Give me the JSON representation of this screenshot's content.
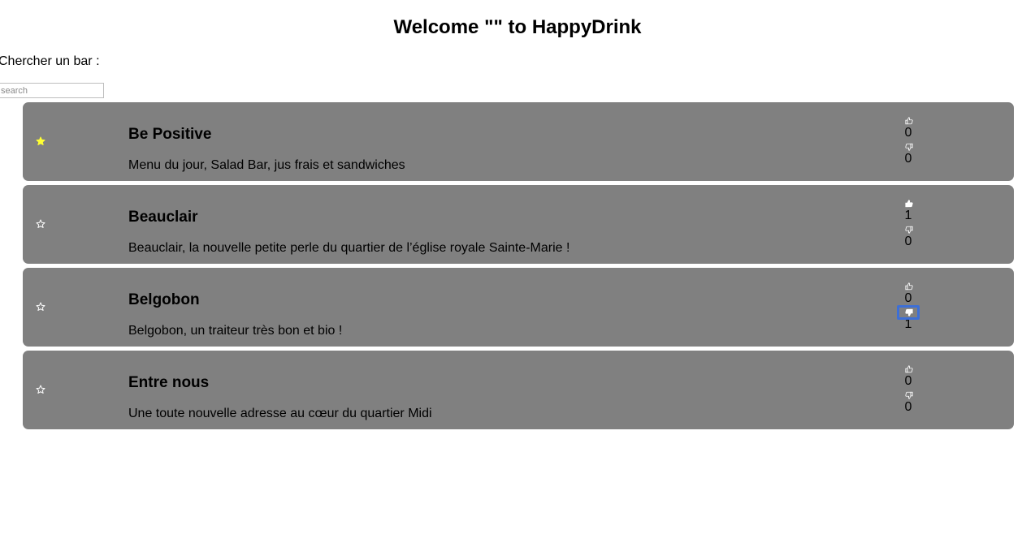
{
  "header": {
    "title": "Welcome \"\" to HappyDrink"
  },
  "search": {
    "label": "Chercher un bar :",
    "placeholder": "search",
    "value": ""
  },
  "colors": {
    "card_bg": "#808080",
    "favorite_star": "#ffff33",
    "focus_ring": "#3d6fd6"
  },
  "bars": [
    {
      "name": "Be Positive",
      "description": "Menu du jour, Salad Bar, jus frais et sandwiches",
      "favorite": true,
      "likes": "0",
      "dislikes": "0",
      "liked": false,
      "disliked": false,
      "focused": ""
    },
    {
      "name": "Beauclair",
      "description": "Beauclair, la nouvelle petite perle du quartier de l’église royale Sainte-Marie !",
      "favorite": false,
      "likes": "1",
      "dislikes": "0",
      "liked": true,
      "disliked": false,
      "focused": ""
    },
    {
      "name": "Belgobon",
      "description": "Belgobon, un traiteur très bon et bio !",
      "favorite": false,
      "likes": "0",
      "dislikes": "1",
      "liked": false,
      "disliked": true,
      "focused": "dislike"
    },
    {
      "name": "Entre nous",
      "description": "Une toute nouvelle adresse au cœur du quartier Midi",
      "favorite": false,
      "likes": "0",
      "dislikes": "0",
      "liked": false,
      "disliked": false,
      "focused": ""
    }
  ],
  "icons": {
    "favorite": "star-icon",
    "like": "thumbs-up-icon",
    "dislike": "thumbs-down-icon"
  }
}
